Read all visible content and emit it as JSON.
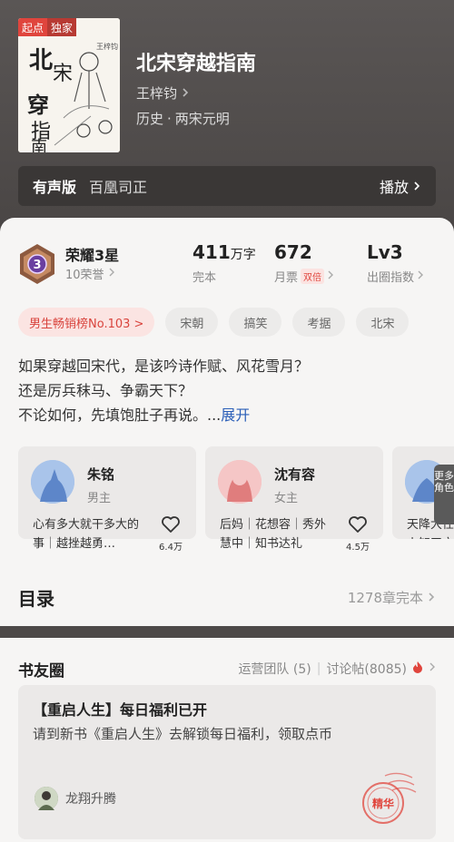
{
  "cover": {
    "tag_platform": "起点",
    "tag_exclusive": "独家"
  },
  "book": {
    "title": "北宋穿越指南",
    "author": "王梓钧",
    "genre_main": "历史",
    "genre_dot": "·",
    "genre_sub": "两宋元明"
  },
  "audio": {
    "label": "有声版",
    "narrator": "百凰司正",
    "play_label": "播放"
  },
  "honor": {
    "badge_level": "3",
    "title": "荣耀3星",
    "subtitle": "10荣誉"
  },
  "stats": [
    {
      "num": "411",
      "unit": "万字",
      "label": "完本"
    },
    {
      "num": "672",
      "unit": "",
      "label": "月票",
      "tag": "双倍"
    },
    {
      "num": "Lv3",
      "unit": "",
      "label": "出圈指数"
    }
  ],
  "tags": [
    {
      "label": "男生畅销榜No.103 >",
      "highlight": true
    },
    {
      "label": "宋朝"
    },
    {
      "label": "搞笑"
    },
    {
      "label": "考据"
    },
    {
      "label": "北宋"
    }
  ],
  "synopsis": {
    "line1": "如果穿越回宋代，是该吟诗作赋、风花雪月？",
    "line2": "还是厉兵秣马、争霸天下？",
    "line3": "不论如何，先填饱肚子再说。...",
    "expand": "展开"
  },
  "characters": [
    {
      "name": "朱铭",
      "role": "男主",
      "desc": "心有多大就干多大的事｜越挫越勇…",
      "likes": "6.4万"
    },
    {
      "name": "沈有容",
      "role": "女主",
      "desc": "后妈｜花想容｜秀外慧中｜知书达礼",
      "likes": "4.5万"
    },
    {
      "name": "",
      "role": "",
      "desc": "天降大任上知天文",
      "likes": ""
    }
  ],
  "more_roles": "更多角色",
  "toc": {
    "title": "目录",
    "summary": "1278章完本"
  },
  "friends": {
    "title": "书友圈",
    "ops": "运营团队 (5)",
    "sep": "|",
    "threads": "讨论帖(8085)",
    "post": {
      "title": "【重启人生】每日福利已开",
      "body": "请到新书《重启人生》去解锁每日福利，领取点币",
      "user": "龙翔升腾",
      "stamp": "精华"
    }
  },
  "colors": {
    "accent_red": "#e0453d",
    "link_blue": "#2b5fb8",
    "badge_purple": "#6a3fa0"
  }
}
